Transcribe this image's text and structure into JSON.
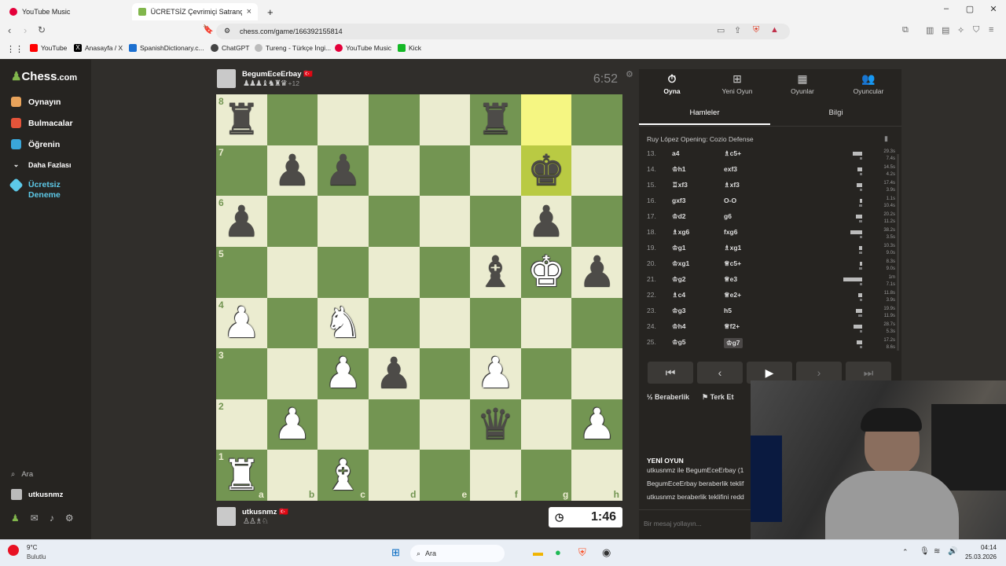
{
  "browser": {
    "tabs": [
      {
        "title": "YouTube Music",
        "active": false
      },
      {
        "title": "ÜCRETSİZ Çevrimiçi Satranç Oyn",
        "active": true
      }
    ],
    "new_tab": "+",
    "url": "chess.com/game/166392155814",
    "bookmarks": [
      "YouTube",
      "Anasayfa / X",
      "SpanishDictionary.c...",
      "ChatGPT",
      "Tureng - Türkçe İngi...",
      "YouTube Music",
      "Kick"
    ]
  },
  "site": {
    "logo": "Chess",
    "logo_suffix": ".com",
    "nav": [
      "Oynayın",
      "Bulmacalar",
      "Öğrenin",
      "Daha Fazlası"
    ],
    "trial": "Ücretsiz Deneme",
    "search": "Ara",
    "username": "utkusnmz"
  },
  "players": {
    "top": {
      "name": "BegumEceErbay",
      "flag": "🇹🇷",
      "captured": "♟♟♟♝♞♜♛",
      "advantage": "+12",
      "clock": "6:52"
    },
    "bottom": {
      "name": "utkusnmz",
      "flag": "🇹🇷",
      "captured": "♙♙♗♘",
      "clock": "1:46"
    }
  },
  "board": {
    "ranks": [
      "8",
      "7",
      "6",
      "5",
      "4",
      "3",
      "2",
      "1"
    ],
    "files": [
      "a",
      "b",
      "c",
      "d",
      "e",
      "f",
      "g",
      "h"
    ],
    "position": [
      [
        "bR",
        "",
        "",
        "",
        "",
        "bR",
        "",
        ""
      ],
      [
        "",
        "bP",
        "bP",
        "",
        "",
        "",
        "bK",
        ""
      ],
      [
        "bP",
        "",
        "",
        "",
        "",
        "",
        "bP",
        ""
      ],
      [
        "",
        "",
        "",
        "",
        "",
        "bB",
        "wK",
        "bP"
      ],
      [
        "wP",
        "",
        "wN",
        "",
        "",
        "",
        "",
        ""
      ],
      [
        "",
        "",
        "wP",
        "bP",
        "",
        "wP",
        "",
        ""
      ],
      [
        "",
        "wP",
        "",
        "",
        "",
        "bQ",
        "",
        "wP"
      ],
      [
        "wR",
        "",
        "wB",
        "",
        "",
        "",
        "",
        ""
      ]
    ],
    "highlight": [
      "g8",
      "g7"
    ]
  },
  "panel": {
    "tabs": [
      "Oyna",
      "Yeni Oyun",
      "Oyunlar",
      "Oyuncular"
    ],
    "subtabs": [
      "Hamleler",
      "Bilgi"
    ],
    "opening": "Ruy López Opening: Cozio Defense",
    "moves": [
      {
        "n": "13.",
        "w": "a4",
        "b": "♗c5+",
        "tw": "29.3s",
        "tb": "7.4s"
      },
      {
        "n": "14.",
        "w": "♔h1",
        "b": "exf3",
        "tw": "14.5s",
        "tb": "4.2s"
      },
      {
        "n": "15.",
        "w": "♖xf3",
        "b": "♗xf3",
        "tw": "17.4s",
        "tb": "3.9s"
      },
      {
        "n": "16.",
        "w": "gxf3",
        "b": "O-O",
        "tw": "1.1s",
        "tb": "10.4s"
      },
      {
        "n": "17.",
        "w": "♔d2",
        "b": "g6",
        "tw": "20.2s",
        "tb": "11.2s"
      },
      {
        "n": "18.",
        "w": "♗xg6",
        "b": "fxg6",
        "tw": "38.2s",
        "tb": "3.5s"
      },
      {
        "n": "19.",
        "w": "♔g1",
        "b": "♗xg1",
        "tw": "10.3s",
        "tb": "9.0s"
      },
      {
        "n": "20.",
        "w": "♔xg1",
        "b": "♕c5+",
        "tw": "8.3s",
        "tb": "9.0s"
      },
      {
        "n": "21.",
        "w": "♔g2",
        "b": "♕e3",
        "tw": "1m",
        "tb": "7.1s"
      },
      {
        "n": "22.",
        "w": "♗c4",
        "b": "♕e2+",
        "tw": "11.8s",
        "tb": "3.9s"
      },
      {
        "n": "23.",
        "w": "♔g3",
        "b": "h5",
        "tw": "19.9s",
        "tb": "11.9s"
      },
      {
        "n": "24.",
        "w": "♔h4",
        "b": "♕f2+",
        "tw": "28.7s",
        "tb": "5.3s"
      },
      {
        "n": "25.",
        "w": "♔g5",
        "b": "♔g7",
        "tw": "17.2s",
        "tb": "8.6s"
      }
    ],
    "draw": "Beraberlik",
    "resign": "Terk Et",
    "chat_title": "YENİ OYUN",
    "chat": [
      "utkusnmz ile BegumEceErbay (1",
      "BegumEceErbay beraberlik teklif",
      "utkusnmz beraberlik teklifini redd"
    ],
    "chat_placeholder": "Bir mesaj yollayın..."
  },
  "taskbar": {
    "weather_temp": "9°C",
    "weather_desc": "Bulutlu",
    "search": "Ara",
    "time": "04:14",
    "date": "25.03.2026"
  }
}
